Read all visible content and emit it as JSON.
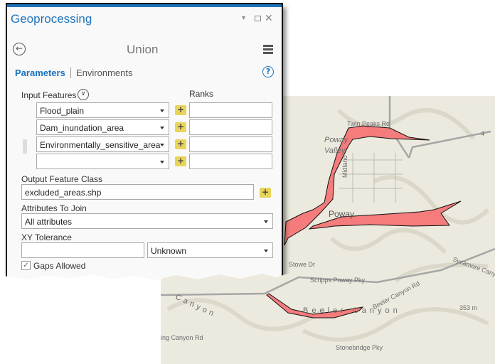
{
  "panel": {
    "title": "Geoprocessing",
    "tool_name": "Union",
    "tabs": [
      {
        "label": "Parameters",
        "active": true
      },
      {
        "label": "Environments",
        "active": false
      }
    ],
    "accent": "#1d73bb"
  },
  "params": {
    "input_features_label": "Input Features",
    "ranks_label": "Ranks",
    "inputs": [
      {
        "value": "Flood_plain",
        "rank": ""
      },
      {
        "value": "Dam_inundation_area",
        "rank": ""
      },
      {
        "value": "Environmentally_sensitive_area",
        "rank": ""
      },
      {
        "value": "",
        "rank": ""
      }
    ],
    "output_label": "Output Feature Class",
    "output_value": "excluded_areas.shp",
    "attributes_label": "Attributes To Join",
    "attributes_value": "All attributes",
    "xy_label": "XY Tolerance",
    "xy_value": "",
    "xy_unit": "Unknown",
    "gaps_label": "Gaps Allowed",
    "gaps_checked": true
  },
  "map": {
    "polygon_color": "#f47c7c",
    "labels": {
      "twin_peaks": "Twin Peaks Rd",
      "poway": "Poway",
      "valley": "Valley",
      "midland": "Midland",
      "poway_town": "Poway",
      "route": "4",
      "stowe": "Stowe Dr",
      "scripps": "Scripps Poway Pky",
      "sycamore": "Sycamore Canyon",
      "beeler_rd": "Beeler Canyon Rd",
      "beeler": "Beeler Canyon",
      "canyon": "Canyon",
      "elev": "353 m",
      "stonebridge": "Stonebridge Pky",
      "ing_canyon": "ing Canyon Rd"
    }
  }
}
